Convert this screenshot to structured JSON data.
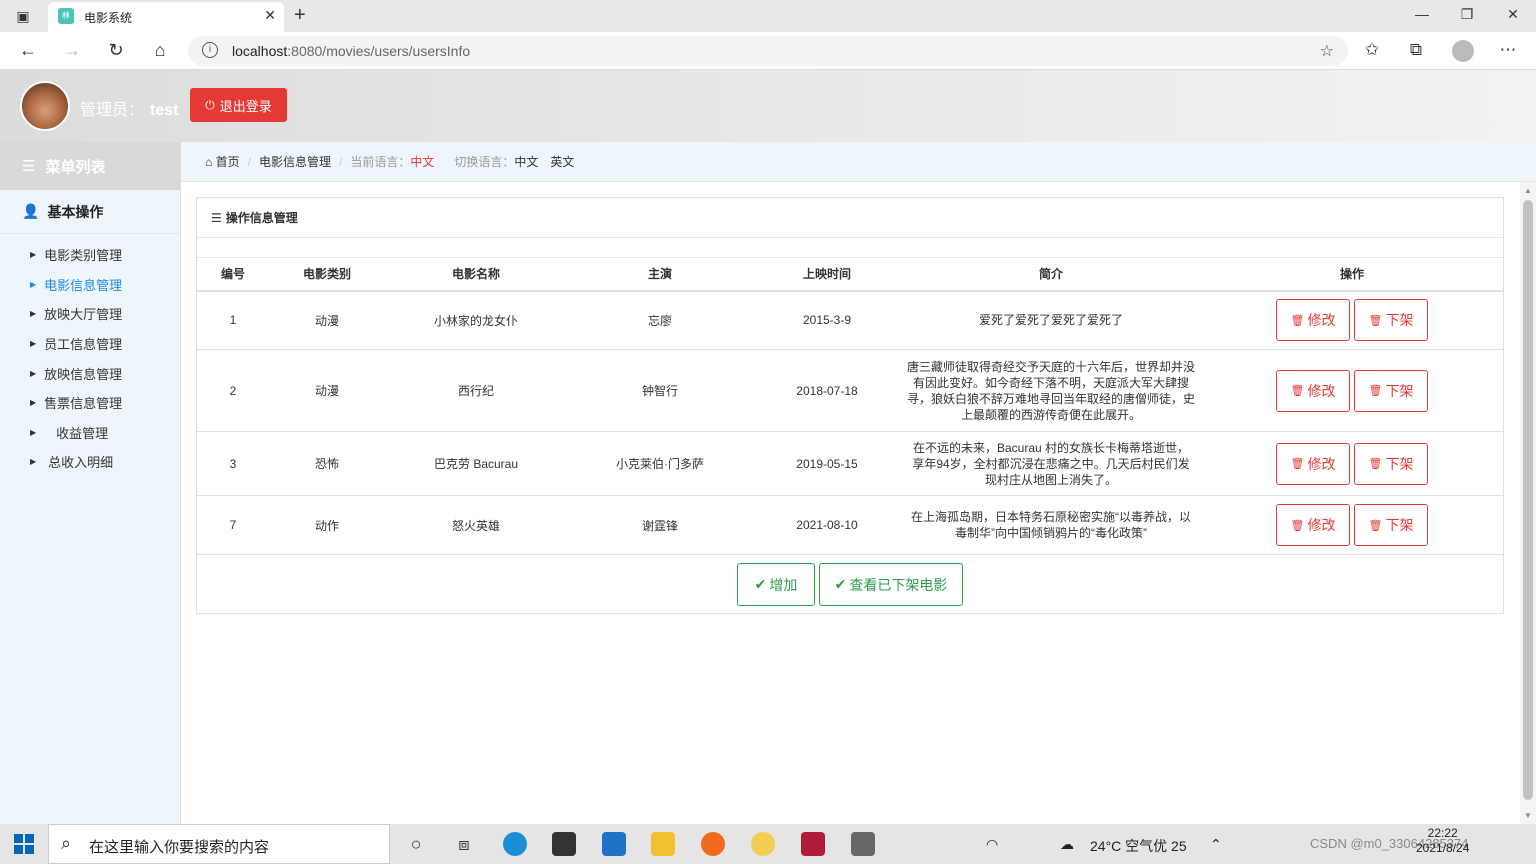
{
  "browser": {
    "tab_title": "电影系统",
    "url_host": "localhost",
    "url_rest": ":8080/movies/users/usersInfo"
  },
  "header": {
    "admin_label": "管理员：",
    "admin_name": "test",
    "logout_label": "退出登录"
  },
  "sidebar": {
    "menu_title": "菜单列表",
    "section_title": "基本操作",
    "items": [
      {
        "label": "电影类别管理"
      },
      {
        "label": "电影信息管理"
      },
      {
        "label": "放映大厅管理"
      },
      {
        "label": "员工信息管理"
      },
      {
        "label": "放映信息管理"
      },
      {
        "label": "售票信息管理"
      },
      {
        "label": "收益管理"
      },
      {
        "label": "总收入明细"
      }
    ]
  },
  "breadcrumb": {
    "home": "首页",
    "current": "电影信息管理",
    "lang_label": "当前语言：",
    "lang_value": "中文",
    "switch_label": "切换语言：",
    "lang_zh": "中文",
    "lang_en": "英文"
  },
  "panel": {
    "title": "操作信息管理",
    "columns": [
      "编号",
      "电影类别",
      "电影名称",
      "主演",
      "上映时间",
      "简介",
      "操作"
    ],
    "rows": [
      {
        "id": "1",
        "category": "动漫",
        "name": "小林家的龙女仆",
        "actor": "忘廖",
        "date": "2015-3-9",
        "intro": "爱死了爱死了爱死了爱死了"
      },
      {
        "id": "2",
        "category": "动漫",
        "name": "西行纪",
        "actor": "钟智行",
        "date": "2018-07-18",
        "intro": "唐三藏师徒取得奇经交予天庭的十六年后，世界却并没有因此变好。如今奇经下落不明，天庭派大军大肆搜寻，狼妖白狼不辞万难地寻回当年取经的唐僧师徒，史上最颠覆的西游传奇便在此展开。"
      },
      {
        "id": "3",
        "category": "恐怖",
        "name": "巴克劳 Bacurau",
        "actor": "小克莱伯·门多萨",
        "date": "2019-05-15",
        "intro": "在不远的未来，Bacurau 村的女族长卡梅蒂塔逝世，享年94岁，全村都沉浸在悲痛之中。几天后村民们发现村庄从地图上消失了。"
      },
      {
        "id": "7",
        "category": "动作",
        "name": "怒火英雄",
        "actor": "谢霆锋",
        "date": "2021-08-10",
        "intro": "在上海孤岛期，日本特务石原秘密实施“以毒养战，以毒制华”向中国倾销鸦片的“毒化政策”"
      }
    ],
    "edit_label": "修改",
    "remove_label": "下架",
    "add_label": "增加",
    "view_removed_label": "查看已下架电影"
  },
  "taskbar": {
    "search_placeholder": "在这里输入你要搜索的内容",
    "weather": "24°C  空气优 25",
    "time": "22:22",
    "date": "2021/8/24",
    "watermark": "CSDN @m0_33064285374"
  }
}
